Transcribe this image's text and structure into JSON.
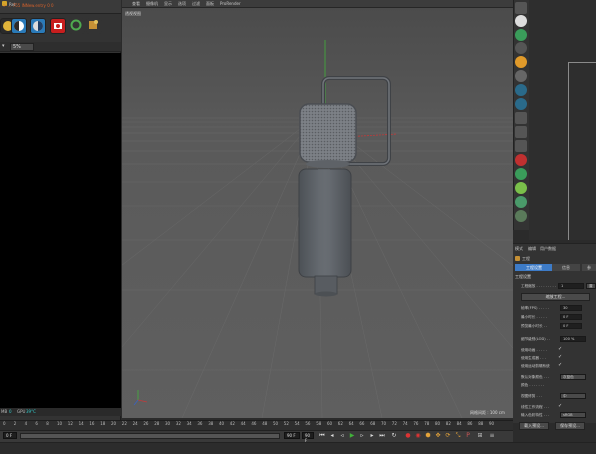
{
  "left": {
    "topbar_label": "Ret",
    "dropdown_value": "5%",
    "console_line": "> ... 755 lNNew.entry 0 0",
    "status_mem_label": "MB",
    "status_mem_value": "0",
    "status_gpu_label": "GPU",
    "status_gpu_value": "39°C"
  },
  "viewport": {
    "menus": [
      "查看",
      "摄像机",
      "显示",
      "选项",
      "过滤",
      "面板",
      "ProRender"
    ],
    "label": "透视视图",
    "grid_spacing": "网格间距 : 100 cm"
  },
  "attributes": {
    "menus": [
      "模式",
      "编辑",
      "用户数据"
    ],
    "section": "工程",
    "tabs": [
      "工程设置",
      "信息",
      "参"
    ],
    "subheading": "工程设置",
    "scale_label": "工程缩放 . . . . . . . . .",
    "scale_value": "1",
    "scale_unit": "厘",
    "scale_button": "缩放工程...",
    "fps_label": "帧率(FPS) . . . . .",
    "fps_value": "30",
    "min_time_label": "最小时长 . . . . .",
    "min_time_value": "0 F",
    "preview_min_label": "预览最小时长 . .",
    "preview_min_value": "0 F",
    "lod_label": "细节级别(LOD) . .",
    "lod_value": "100 %",
    "use_anim_label": "使用动画 . . . . .",
    "use_gen_label": "使用生成器 . . .",
    "use_motion_label": "使用运动剪辑系统",
    "default_color_label": "默认对象颜色 . . .",
    "default_color_value": "灰蓝色",
    "color_label": "颜色 . . . . . . .",
    "view_clip_label": "视图修剪 . . .",
    "view_clip_value": "中",
    "linear_label": "线性工作流程 . . .",
    "input_color_label": "输入色彩特性 . . .",
    "input_color_value": "sRGB",
    "load_preset_button": "载入预设...",
    "save_preset_button": "保存预设..."
  },
  "timeline": {
    "ticks": [
      "0",
      "2",
      "4",
      "6",
      "8",
      "10",
      "12",
      "14",
      "16",
      "18",
      "20",
      "22",
      "24",
      "26",
      "28",
      "30",
      "32",
      "34",
      "36",
      "38",
      "40",
      "42",
      "44",
      "46",
      "48",
      "50",
      "52",
      "54",
      "56",
      "58",
      "60",
      "62",
      "64",
      "66",
      "68",
      "70",
      "72",
      "74",
      "76",
      "78",
      "80",
      "82",
      "84",
      "86",
      "88",
      "90"
    ],
    "frame_start": "0 F",
    "frame_end": "90 F",
    "current": "90 F"
  },
  "colors": {
    "accent": "#3d7bc7",
    "console_text": "#d8622b",
    "axis_green": "#41b13a",
    "axis_red": "#c23a3a"
  }
}
